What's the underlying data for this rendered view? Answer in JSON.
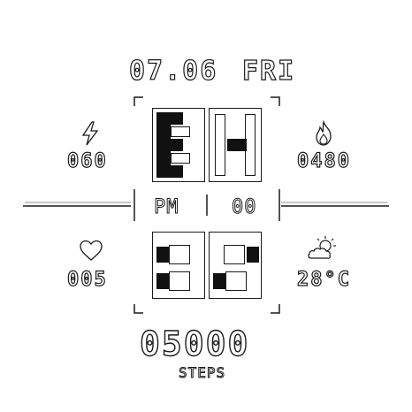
{
  "date": "07.06",
  "weekday": "FRI",
  "ampm": "PM",
  "seconds": "00",
  "hour_digits": [
    "1",
    "0"
  ],
  "minute_digits": [
    "3",
    "5"
  ],
  "energy_value": "060",
  "calories_value": "0480",
  "heart_value": "005",
  "temperature_value": "28°C",
  "steps_value": "05000",
  "steps_label": "STEPS",
  "icons": {
    "energy": "lightning-icon",
    "calories": "flame-icon",
    "heart": "heart-icon",
    "weather": "sun-cloud-icon"
  },
  "colors": {
    "ink": "#1a1a1a",
    "background": "#ffffff"
  }
}
